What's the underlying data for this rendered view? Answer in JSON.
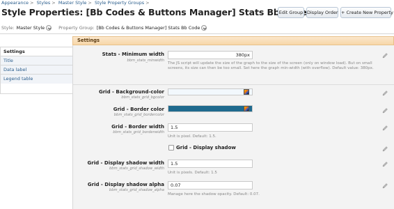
{
  "breadcrumb": [
    "Appearance",
    "Styles",
    "Master Style",
    "Style Property Groups"
  ],
  "page_title": "Style Properties: [Bb Codes & Buttons Manager] Stats Bb Code",
  "buttons": {
    "edit_group": "Edit Group",
    "display_order": "Display Order",
    "create_new": "+ Create New Property"
  },
  "filters": {
    "style_label": "Style:",
    "style_value": "Master Style",
    "group_label": "Property Group:",
    "group_value": "[Bb Codes & Buttons Manager] Stats Bb Code"
  },
  "tabs": [
    "Settings",
    "Title",
    "Data label",
    "Legend table"
  ],
  "section_title": "Settings",
  "fields": [
    {
      "label": "Stats - Minimum width",
      "sub": "bbm_stats_minwidth",
      "value": "380px",
      "help": "The JS script will update the size of the graph to the size of the screen (only on window load). But on small screens, its size can then be too small. Set here the graph min-width (with overflow). Default value: 380px."
    },
    {
      "label": "Grid - Background-color",
      "sub": "bbm_stats_grid_bgcolor",
      "value": ""
    },
    {
      "label": "Grid - Border color",
      "sub": "bbm_stats_grid_bordercolor",
      "value": ""
    },
    {
      "label": "Grid - Border width",
      "sub": "bbm_stats_grid_borderwidth",
      "value": "1.5",
      "help": "Unit is pixel. Default: 1.5."
    },
    {
      "label": "Grid - Display shadow"
    },
    {
      "label": "Grid - Display shadow width",
      "sub": "bbm_stats_grid_shadow_width",
      "value": "1.5",
      "help": "Unit is pixels. Default: 1.5"
    },
    {
      "label": "Grid - Display shadow alpha",
      "sub": "bbm_stats_grid_shadow_alpha",
      "value": "0.07",
      "help": "Manage here the shadow opacity. Default: 0.07."
    }
  ],
  "colors": {
    "bg_color_value": "#f2f8fd",
    "border_color_value": "#1f6a8e",
    "header_bg": "#f8dcb4",
    "link": "#2a5d8c"
  },
  "icons": [
    "chevron-down-icon",
    "color-picker-icon",
    "edit-pencil-icon"
  ]
}
